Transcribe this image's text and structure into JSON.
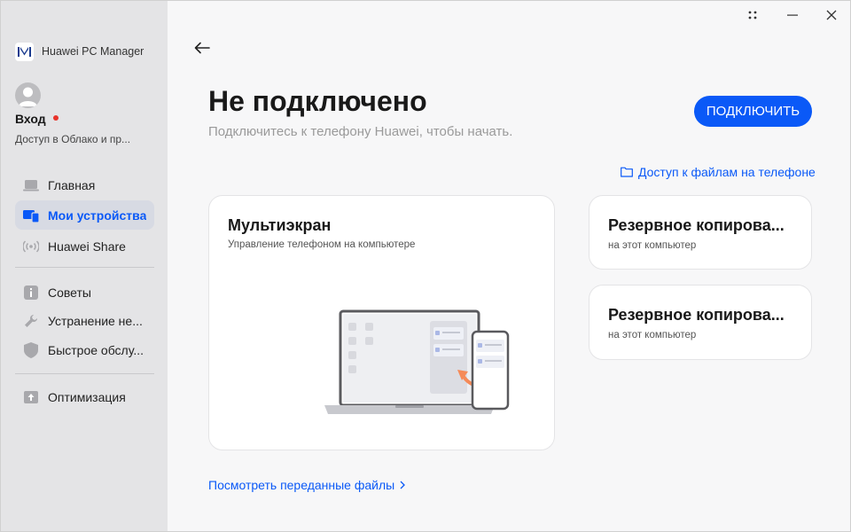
{
  "app": {
    "title": "Huawei PC Manager"
  },
  "window": {
    "controls": [
      "drag-icon",
      "minimize-icon",
      "close-icon"
    ]
  },
  "account": {
    "login_label": "Вход",
    "cloud_label": "Доступ в Облако и пр..."
  },
  "sidebar": {
    "items": [
      {
        "label": "Главная",
        "icon": "laptop-icon",
        "active": false
      },
      {
        "label": "Мои устройства",
        "icon": "devices-icon",
        "active": true
      },
      {
        "label": "Huawei Share",
        "icon": "share-signal-icon",
        "active": false
      },
      {
        "label": "Советы",
        "icon": "tips-icon",
        "active": false
      },
      {
        "label": "Устранение не...",
        "icon": "wrench-icon",
        "active": false
      },
      {
        "label": "Быстрое обслу...",
        "icon": "shield-icon",
        "active": false
      },
      {
        "label": "Оптимизация",
        "icon": "optimize-icon",
        "active": false
      }
    ]
  },
  "main": {
    "title": "Не подключено",
    "subtitle": "Подключитесь к телефону Huawei, чтобы начать.",
    "connect_button": "ПОДКЛЮЧИТЬ",
    "files_link": "Доступ к файлам на телефоне",
    "multiscreen": {
      "title": "Мультиэкран",
      "subtitle": "Управление телефоном на компьютере"
    },
    "backup_cards": [
      {
        "title": "Резервное копирова...",
        "subtitle": "на этот компьютер"
      },
      {
        "title": "Резервное копирова...",
        "subtitle": "на этот компьютер"
      }
    ],
    "transfer_link": "Посмотреть переданные файлы"
  },
  "colors": {
    "accent": "#0a59f7",
    "sidebar_bg": "#e4e4e6",
    "main_bg": "#f7f7f8",
    "status_dot": "#e8332b"
  }
}
